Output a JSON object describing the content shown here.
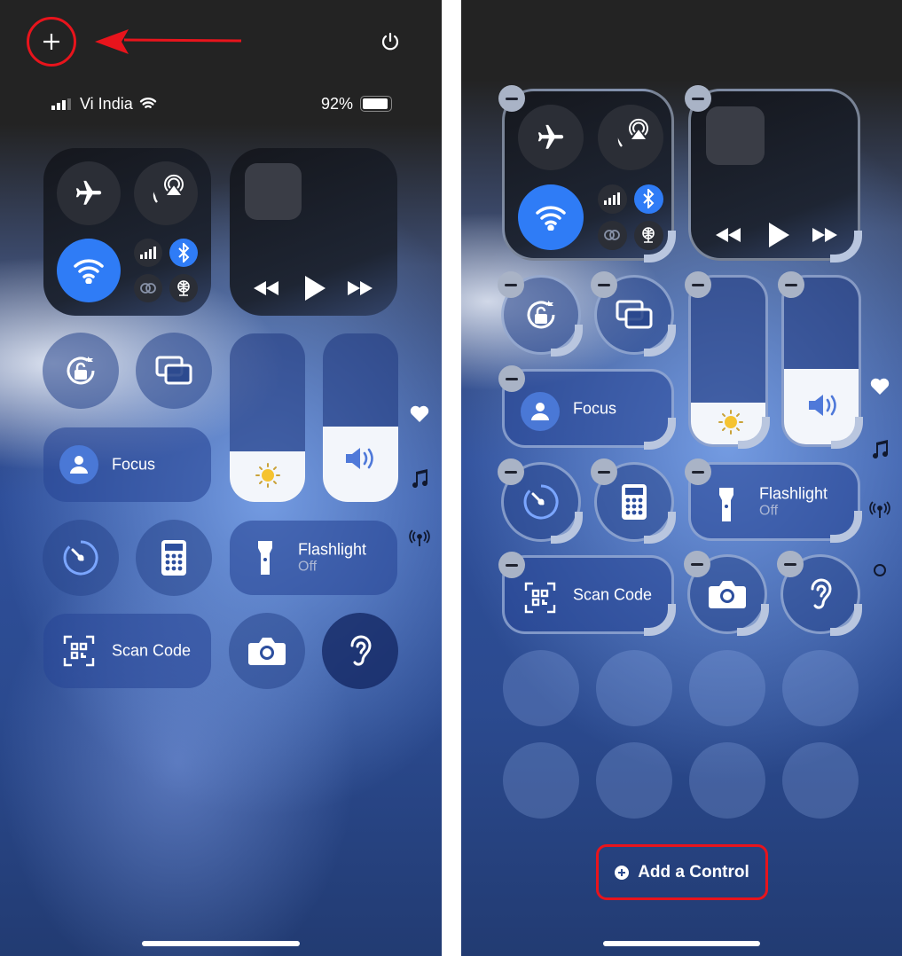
{
  "left_screen": {
    "add_icon": "plus-icon",
    "power_icon": "power-icon",
    "status_bar": {
      "carrier": "Vi India",
      "battery_percent": "92%",
      "battery_level": 92
    },
    "controls": {
      "focus": "Focus",
      "flashlight": "Flashlight",
      "flashlight_state": "Off",
      "scan_code": "Scan Code"
    },
    "brightness_level": 30,
    "volume_level": 45,
    "annotation_color": "#e8141c"
  },
  "right_screen": {
    "controls": {
      "focus": "Focus",
      "flashlight": "Flashlight",
      "flashlight_state": "Off",
      "scan_code": "Scan Code"
    },
    "brightness_level": 25,
    "volume_level": 45,
    "add_control_label": "Add a Control"
  },
  "colors": {
    "accent_blue": "#2f7cf6",
    "annotation_red": "#e8141c"
  }
}
